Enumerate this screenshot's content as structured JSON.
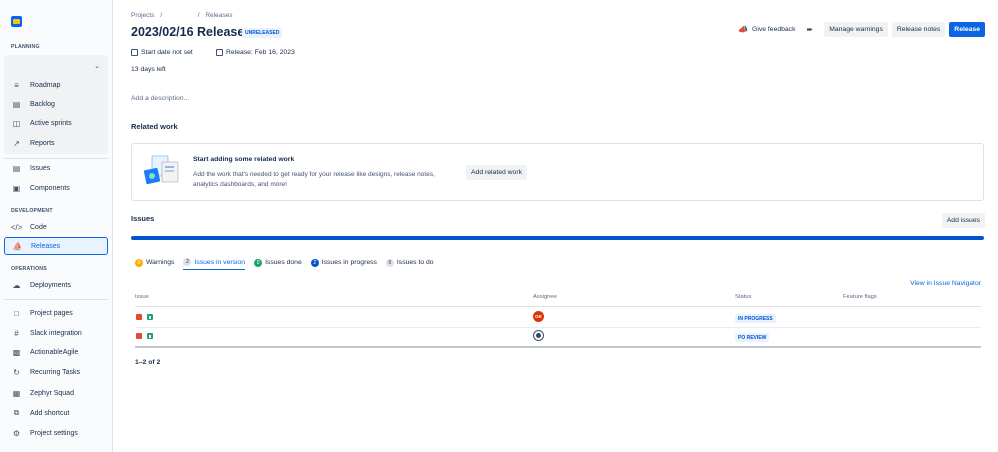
{
  "sidebar": {
    "planning_label": "PLANNING",
    "development_label": "DEVELOPMENT",
    "operations_label": "OPERATIONS",
    "planning_items": [
      {
        "label": "Roadmap",
        "icon": "roadmap-icon"
      },
      {
        "label": "Backlog",
        "icon": "backlog-icon"
      },
      {
        "label": "Active sprints",
        "icon": "board-icon"
      },
      {
        "label": "Reports",
        "icon": "reports-icon"
      }
    ],
    "general_items": [
      {
        "label": "Issues",
        "icon": "issues-icon"
      },
      {
        "label": "Components",
        "icon": "components-icon"
      }
    ],
    "development_items": [
      {
        "label": "Code",
        "icon": "code-icon"
      },
      {
        "label": "Releases",
        "icon": "ship-icon",
        "active": true
      }
    ],
    "operations_items": [
      {
        "label": "Deployments",
        "icon": "cloud-icon"
      }
    ],
    "app_items": [
      {
        "label": "Project pages",
        "icon": "page-icon"
      },
      {
        "label": "Slack integration",
        "icon": "slack-icon"
      },
      {
        "label": "ActionableAgile",
        "icon": "chart-icon"
      },
      {
        "label": "Recurring Tasks",
        "icon": "refresh-icon"
      },
      {
        "label": "Zephyr Squad",
        "icon": "zephyr-icon"
      },
      {
        "label": "Add shortcut",
        "icon": "add-shortcut-icon"
      },
      {
        "label": "Project settings",
        "icon": "gear-icon"
      }
    ]
  },
  "breadcrumb": {
    "projects": "Projects",
    "sep": "/",
    "releases": "Releases"
  },
  "release": {
    "title": "2023/02/16 Release",
    "status": "UNRELEASED",
    "start_date": "Start date not set",
    "release_date": "Release: Feb 16, 2023",
    "days_left": "13 days left",
    "description_placeholder": "Add a description..."
  },
  "actions": {
    "give_feedback": "Give feedback",
    "manage_warnings": "Manage warnings",
    "release_notes": "Release notes",
    "release": "Release"
  },
  "related_work": {
    "heading": "Related work",
    "title": "Start adding some related work",
    "text": "Add the work that's needed to get ready for your release like designs, release notes, analytics dashboards, and more!",
    "button": "Add related work"
  },
  "issues": {
    "heading": "Issues",
    "add_button": "Add issues",
    "progress_percent": 100,
    "view_link": "View in Issue Navigator",
    "tabs": [
      {
        "count": "0",
        "label": "Warnings",
        "badge": "warn"
      },
      {
        "count": "2",
        "label": "Issues in version",
        "badge": "grey",
        "active": true
      },
      {
        "count": "0",
        "label": "Issues done",
        "badge": "green"
      },
      {
        "count": "2",
        "label": "Issues in progress",
        "badge": "blue"
      },
      {
        "count": "0",
        "label": "Issues to do",
        "badge": "grey"
      }
    ],
    "columns": {
      "issue": "Issue",
      "assignee": "Assignee",
      "status": "Status",
      "flags": "Feature flags"
    },
    "rows": [
      {
        "assignee_initials": "GK",
        "status": "IN PROGRESS"
      },
      {
        "assignee_initials": "",
        "status": "PO REVIEW"
      }
    ],
    "count_text": "1–2 of 2"
  },
  "colors": {
    "accent": "#0c66e4",
    "progress": "#0055cc",
    "bug": "#e34935",
    "story": "#22a06b"
  }
}
